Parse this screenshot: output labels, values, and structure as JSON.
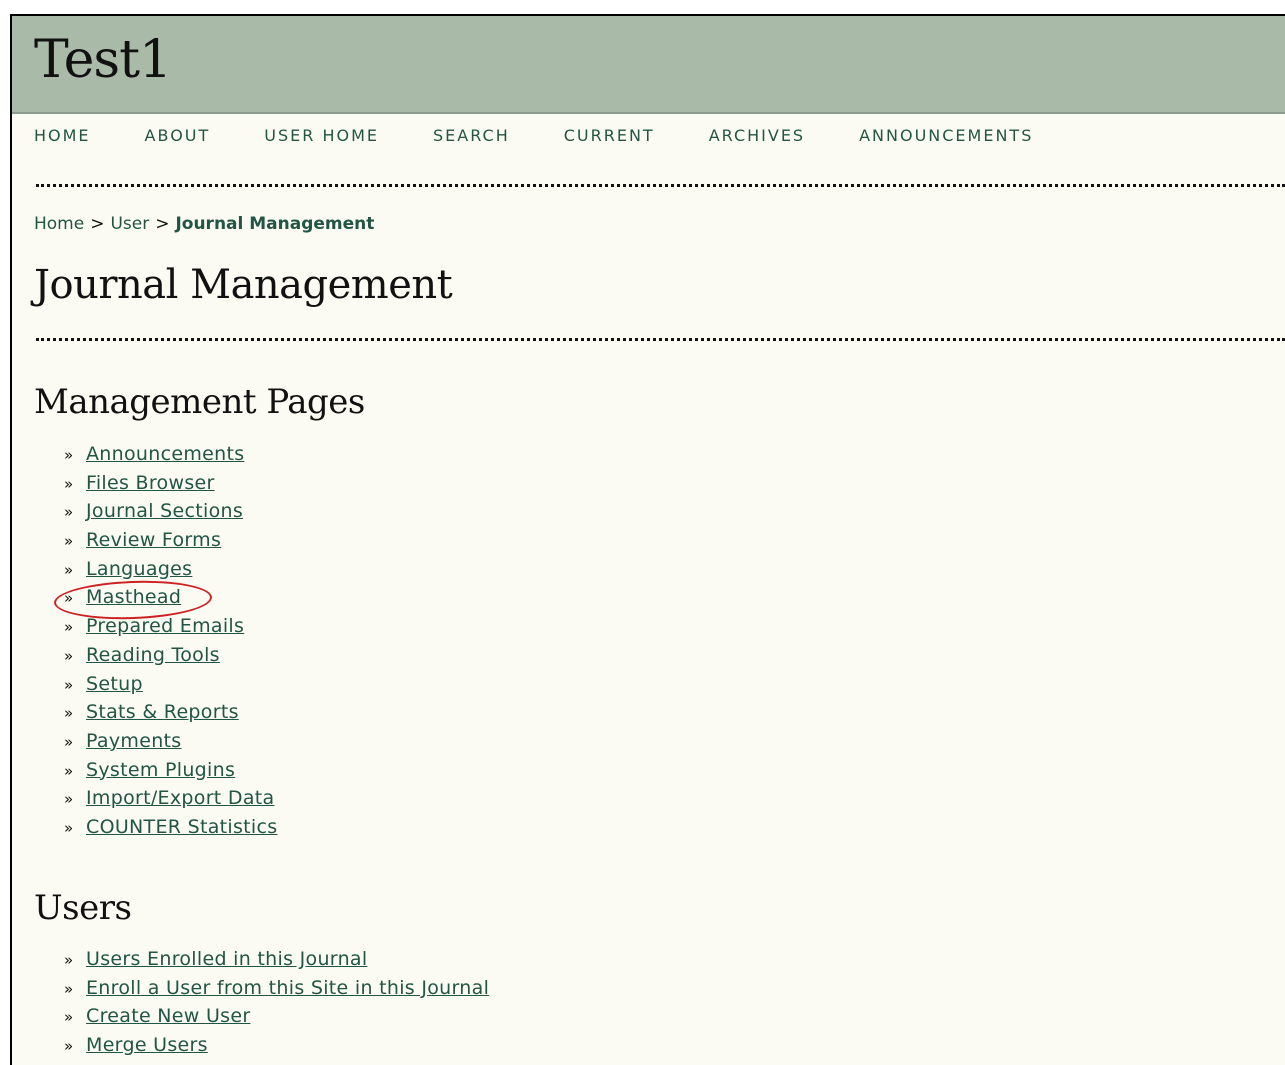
{
  "site": {
    "title": "Test1"
  },
  "nav": {
    "items": [
      "HOME",
      "ABOUT",
      "USER HOME",
      "SEARCH",
      "CURRENT",
      "ARCHIVES",
      "ANNOUNCEMENTS"
    ]
  },
  "breadcrumb": {
    "home": "Home",
    "user": "User",
    "current": "Journal Management",
    "separator": ">"
  },
  "page": {
    "title": "Journal Management"
  },
  "management": {
    "heading": "Management Pages",
    "bullet": "»",
    "items": [
      "Announcements",
      "Files Browser",
      "Journal Sections",
      "Review Forms",
      "Languages",
      "Masthead",
      "Prepared Emails",
      "Reading Tools",
      "Setup",
      "Stats & Reports",
      "Payments",
      "System Plugins",
      "Import/Export Data",
      "COUNTER Statistics"
    ]
  },
  "users": {
    "heading": "Users",
    "items": [
      "Users Enrolled in this Journal",
      "Enroll a User from this Site in this Journal",
      "Create New User",
      "Merge Users"
    ]
  },
  "colors": {
    "header_bg": "#a9bba8",
    "link": "#225544",
    "page_bg": "#fbfbf4",
    "annotation": "#cc2222"
  }
}
